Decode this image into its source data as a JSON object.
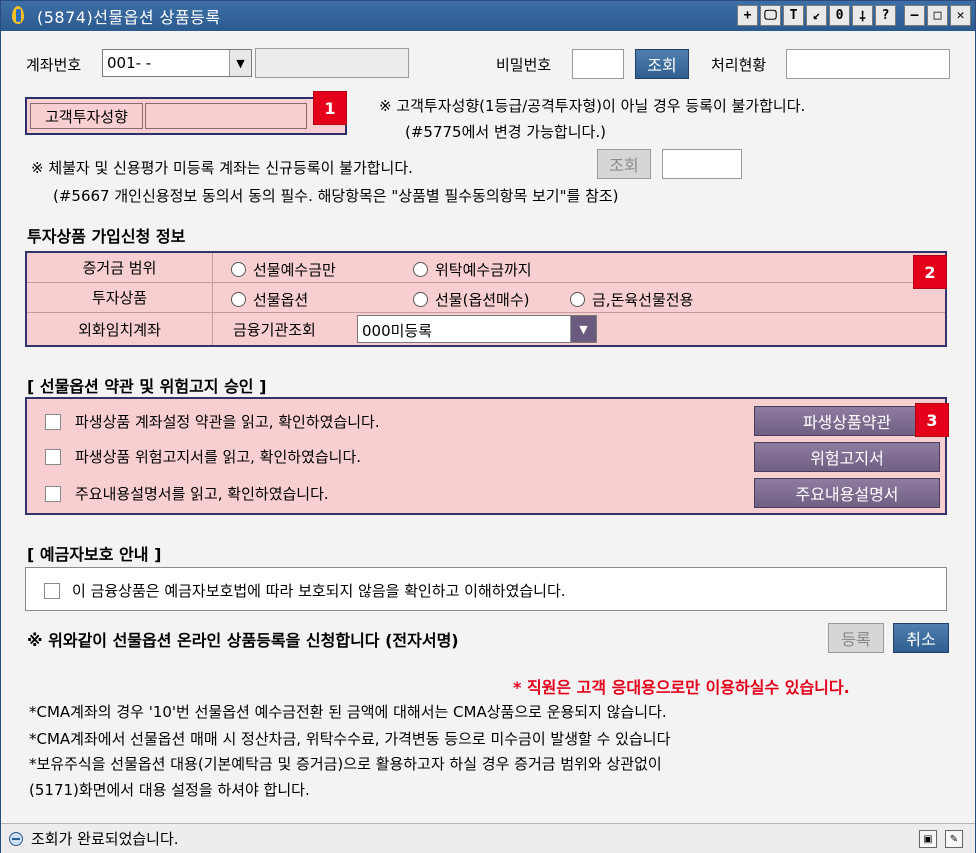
{
  "window": {
    "title": "(5874)선물옵션 상품등록",
    "tools": [
      "+",
      "🖵",
      "T",
      "↙",
      "0",
      "⸸",
      "?"
    ],
    "controls": [
      "–",
      "□",
      "✕"
    ]
  },
  "account": {
    "label": "계좌번호",
    "value": "001-   -",
    "password_label": "비밀번호",
    "lookup_button": "조회",
    "status_label": "처리현황"
  },
  "investor": {
    "label": "고객투자성향",
    "badge": "1",
    "notice_line1": "※ 고객투자성향(1등급/공격투자형)이 아닐 경우 등록이 불가합니다.",
    "notice_line2": "(#5775에서 변경 가능합니다.)"
  },
  "credit": {
    "notice_line1": "※ 체불자 및 신용평가 미등록 계좌는 신규등록이 불가합니다.",
    "notice_line2": "(#5667 개인신용정보 동의서 동의 필수. 해당항목은 \"상품별 필수동의항목 보기\"를 참조)",
    "lookup_button": "조회"
  },
  "product_info": {
    "heading": "투자상품 가입신청 정보",
    "badge": "2",
    "rows": [
      {
        "label": "증거금 범위",
        "options": [
          "선물예수금만",
          "위탁예수금까지"
        ]
      },
      {
        "label": "투자상품",
        "options": [
          "선물옵션",
          "선물(옵션매수)",
          "금,돈육선물전용"
        ]
      },
      {
        "label": "외화임치계좌",
        "sublabel": "금융기관조회",
        "select_value": "000미등록"
      }
    ]
  },
  "terms": {
    "heading": "[ 선물옵션 약관 및 위험고지 승인 ]",
    "badge": "3",
    "items": [
      {
        "text": "파생상품 계좌설정 약관을 읽고, 확인하였습니다.",
        "button": "파생상품약관"
      },
      {
        "text": "파생상품 위험고지서를 읽고, 확인하였습니다.",
        "button": "위험고지서"
      },
      {
        "text": "주요내용설명서를 읽고, 확인하였습니다.",
        "button": "주요내용설명서"
      }
    ]
  },
  "deposit": {
    "heading": "[ 예금자보호 안내 ]",
    "item": "이 금융상품은 예금자보호법에 따라 보호되지 않음을 확인하고 이해하였습니다."
  },
  "apply": {
    "text": "※ 위와같이 선물옵션 온라인 상품등록을 신청합니다 (전자서명)",
    "register_button": "등록",
    "cancel_button": "취소"
  },
  "staff_notice": "* 직원은 고객 응대용으로만 이용하실수 있습니다.",
  "notes": [
    "*CMA계좌의 경우 '10'번 선물옵션 예수금전환 된 금액에 대해서는 CMA상품으로 운용되지 않습니다.",
    "*CMA계좌에서 선물옵션 매매 시 정산차금, 위탁수수료, 가격변동 등으로 미수금이 발생할 수 있습니다",
    "*보유주식을 선물옵션 대용(기본예탁금 및 증거금)으로 활용하고자 하실 경우 증거금 범위와 상관없이",
    " (5171)화면에서 대용 설정을 하셔야 합니다."
  ],
  "status": {
    "text": "조회가 완료되었습니다."
  },
  "colors": {
    "title_bar": "#2b5a8f",
    "pink_fill": "#f7cfd1",
    "box_border": "#33336e",
    "badge": "#e4001b",
    "primary_button": "#2f5f8f",
    "purple_button": "#6f5f83"
  }
}
